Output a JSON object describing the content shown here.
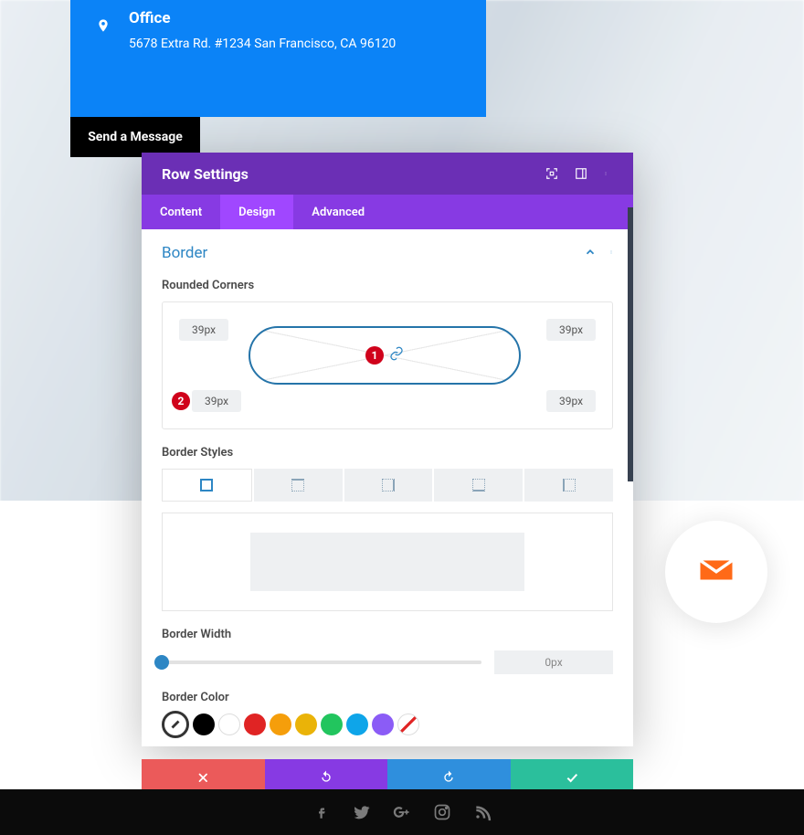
{
  "office": {
    "title": "Office",
    "address": "5678 Extra Rd. #1234 San Francisco, CA 96120"
  },
  "send_message_label": "Send a Message",
  "modal": {
    "title": "Row Settings",
    "tabs": {
      "content": "Content",
      "design": "Design",
      "advanced": "Advanced"
    },
    "section_title": "Border",
    "labels": {
      "rounded": "Rounded Corners",
      "styles": "Border Styles",
      "width": "Border Width",
      "color": "Border Color"
    },
    "rounded_values": {
      "tl": "39px",
      "tr": "39px",
      "bl": "39px",
      "br": "39px"
    },
    "badges": {
      "link": "1",
      "bl": "2"
    },
    "width_value": "0px",
    "colors": {
      "selected": "#ffffff",
      "palette": [
        "#000000",
        "#ffffff",
        "#e02424",
        "#f59e0b",
        "#eab308",
        "#22c55e",
        "#0ea5e9",
        "#8b5cf6"
      ]
    }
  }
}
